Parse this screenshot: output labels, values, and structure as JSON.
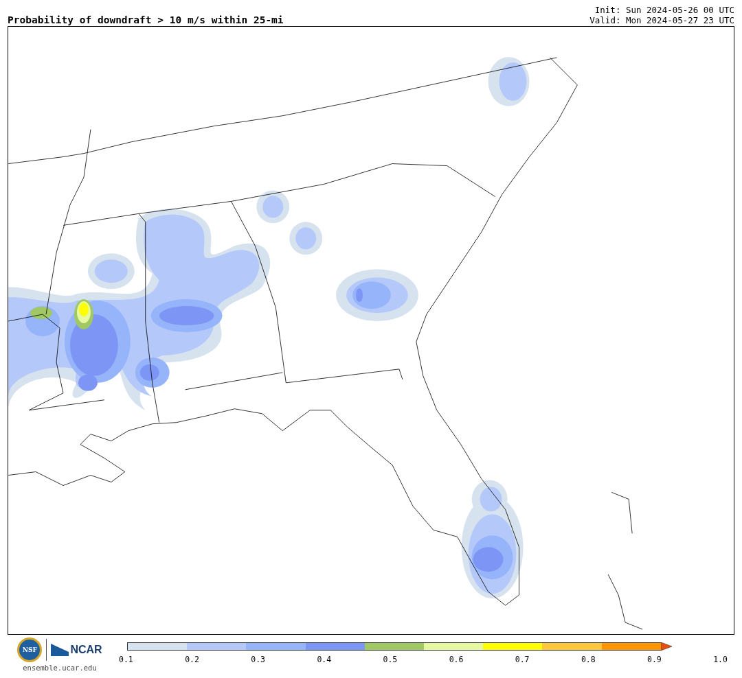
{
  "header": {
    "title": "Probability of downdraft > 10 m/s within 25-mi",
    "init": "Init: Sun 2024-05-26 00 UTC",
    "valid": "Valid: Mon 2024-05-27 23 UTC"
  },
  "footer": {
    "logos": {
      "nsf": "NSF",
      "ncar": "NCAR"
    },
    "url": "ensemble.ucar.edu"
  },
  "colorbar": {
    "segments": [
      {
        "color": "#d6e2ee"
      },
      {
        "color": "#b4c8fa"
      },
      {
        "color": "#96b4fa"
      },
      {
        "color": "#7d96f5"
      },
      {
        "color": "#a0c864"
      },
      {
        "color": "#e6f8a0"
      },
      {
        "color": "#ffff00"
      },
      {
        "color": "#ffc83c"
      },
      {
        "color": "#ff9600"
      }
    ],
    "extension": {
      "color": "#e84e0e"
    },
    "ticks": [
      "0.1",
      "0.2",
      "0.3",
      "0.4",
      "0.5",
      "0.6",
      "0.7",
      "0.8",
      "0.9",
      "1.0"
    ]
  }
}
